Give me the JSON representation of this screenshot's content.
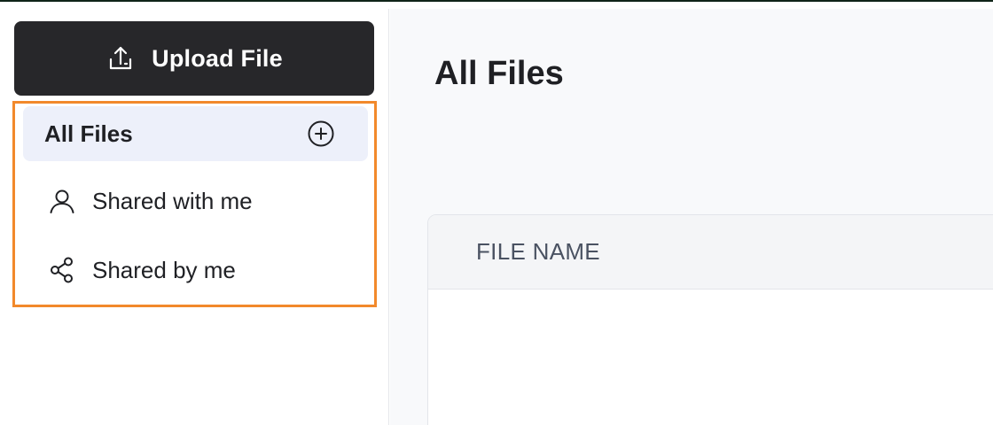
{
  "sidebar": {
    "upload_button": {
      "label": "Upload File",
      "icon": "upload-icon"
    },
    "nav": [
      {
        "label": "All Files",
        "icon": "add-circle-icon",
        "active": true
      },
      {
        "label": "Shared with me",
        "icon": "user-icon",
        "active": false
      },
      {
        "label": "Shared by me",
        "icon": "share-icon",
        "active": false
      }
    ]
  },
  "main": {
    "title": "All Files",
    "table": {
      "columns": [
        "FILE NAME"
      ]
    }
  },
  "colors": {
    "upload_button_bg": "#27272a",
    "active_nav_bg": "#edf0fa",
    "highlight_border": "#f2892b",
    "main_bg": "#f8f9fb"
  }
}
